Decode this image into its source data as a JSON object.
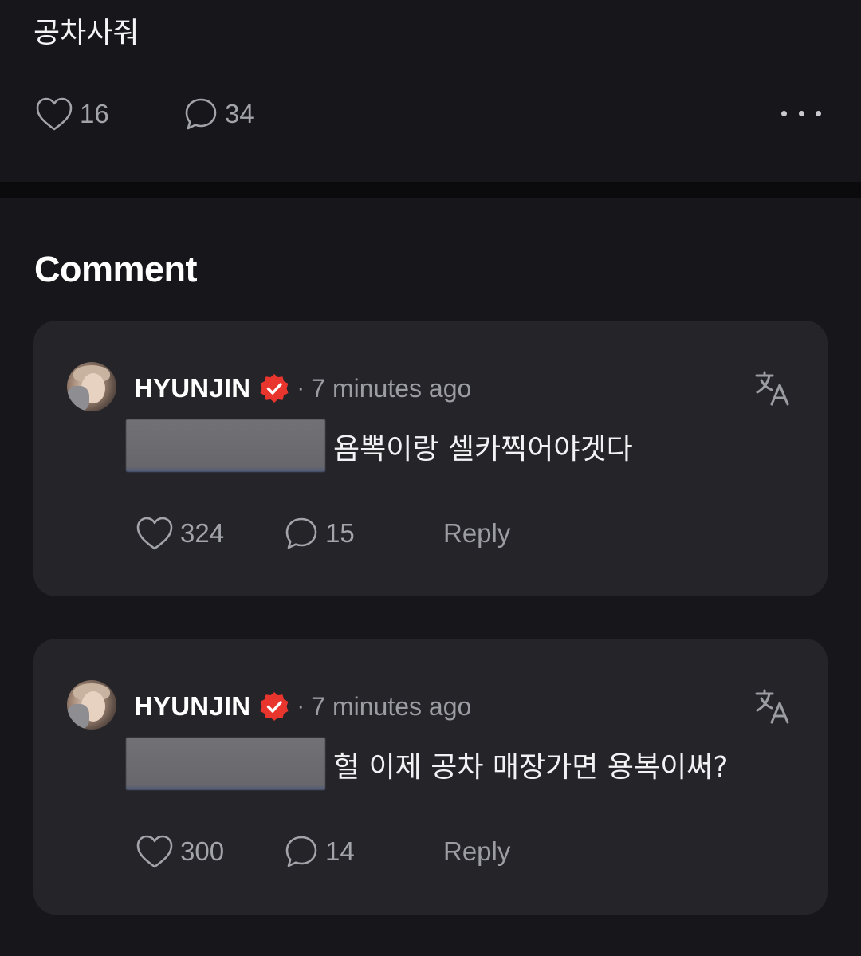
{
  "post": {
    "text": "공차사줘",
    "like_count": "16",
    "comment_count": "34"
  },
  "comments_section": {
    "heading": "Comment"
  },
  "comments": [
    {
      "username": "HYUNJIN",
      "separator": "·",
      "time": "7 minutes ago",
      "text": "욤뽁이랑 셀카찍어야겟다",
      "like_count": "324",
      "reply_count": "15",
      "reply_label": "Reply"
    },
    {
      "username": "HYUNJIN",
      "separator": "·",
      "time": "7 minutes ago",
      "text": "헐 이제 공차 매장가면 용복이써?",
      "like_count": "300",
      "reply_count": "14",
      "reply_label": "Reply"
    }
  ],
  "icons": {
    "like": "heart-icon",
    "comment": "speech-bubble-icon",
    "more": "more-dots-icon",
    "verified": "verified-badge-icon",
    "translate": "translate-icon"
  },
  "colors": {
    "background": "#17171b",
    "card": "#242429",
    "divider": "#0b0b0d",
    "verified_badge": "#e8352d",
    "muted_text": "#9c9ca3"
  }
}
